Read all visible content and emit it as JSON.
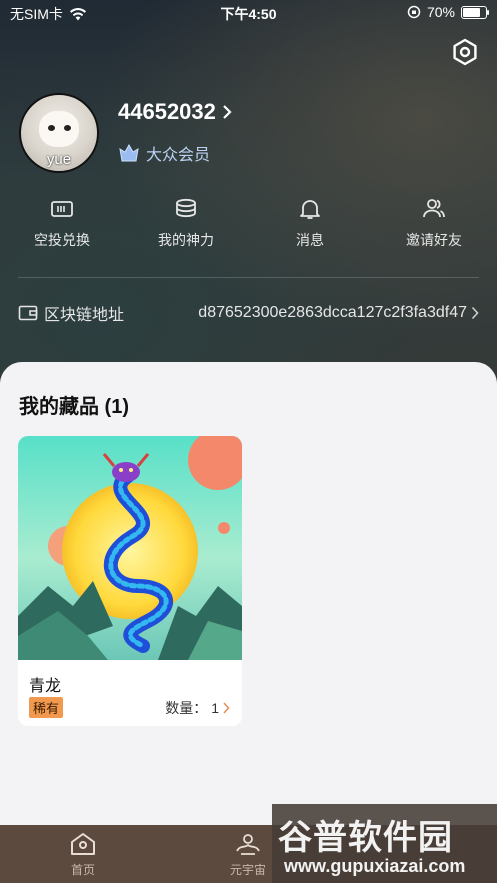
{
  "status_bar": {
    "carrier": "无SIM卡",
    "time": "下午4:50",
    "battery": "70%",
    "battery_level": 0.7
  },
  "profile": {
    "avatar_name": "yue",
    "user_id": "44652032",
    "member_level": "大众会员"
  },
  "quick_actions": [
    {
      "label": "空投兑换",
      "icon": "ticket-icon"
    },
    {
      "label": "我的神力",
      "icon": "coins-icon"
    },
    {
      "label": "消息",
      "icon": "bell-icon"
    },
    {
      "label": "邀请好友",
      "icon": "users-icon"
    }
  ],
  "chain": {
    "label": "区块链地址",
    "address": "d87652300e2863dcca127c2f3fa3df47"
  },
  "collection": {
    "title": "我的藏品 (1)",
    "items": [
      {
        "name": "青龙",
        "rarity": "稀有",
        "quantity_label": "数量：",
        "quantity": "1"
      }
    ]
  },
  "tabbar": [
    {
      "label": "首页",
      "icon": "home-icon"
    },
    {
      "label": "元宇宙",
      "icon": "metaverse-icon"
    }
  ],
  "watermark": {
    "title": "谷普软件园",
    "url": "www.gupuxiazai.com"
  }
}
